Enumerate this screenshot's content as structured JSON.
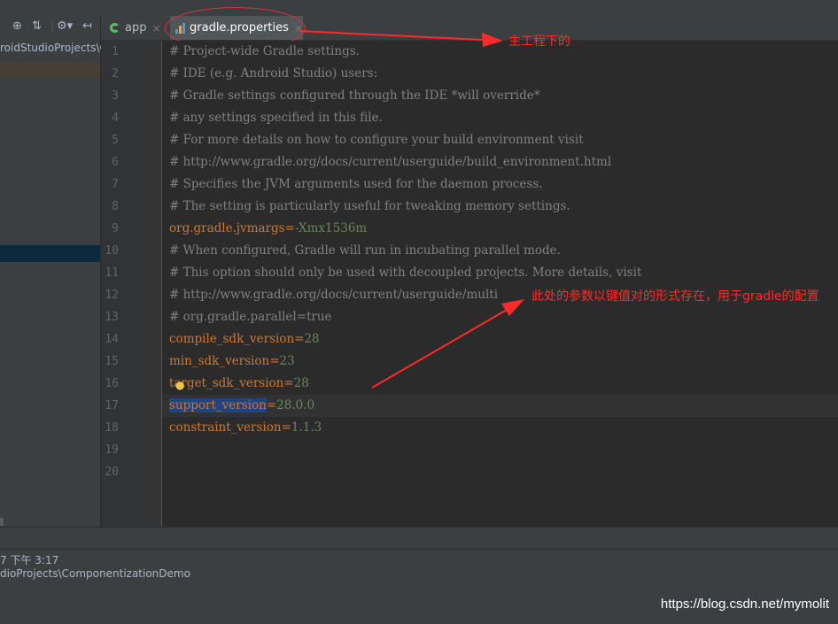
{
  "project_panel": {
    "path_fragment": "roidStudioProjects\\C"
  },
  "tabs": [
    {
      "label": "app",
      "close": "×"
    },
    {
      "label": "gradle.properties",
      "close": "×"
    }
  ],
  "editor": {
    "lines": [
      {
        "num": "1",
        "comment": "# Project-wide Gradle settings."
      },
      {
        "num": "2",
        "comment": "# IDE (e.g. Android Studio) users:"
      },
      {
        "num": "3",
        "comment": "# Gradle settings configured through the IDE *will override*"
      },
      {
        "num": "4",
        "comment": "# any settings specified in this file."
      },
      {
        "num": "5",
        "comment": "# For more details on how to configure your build environment visit"
      },
      {
        "num": "6",
        "comment": "# http://www.gradle.org/docs/current/userguide/build_environment.html"
      },
      {
        "num": "7",
        "comment": "# Specifies the JVM arguments used for the daemon process."
      },
      {
        "num": "8",
        "comment": "# The setting is particularly useful for tweaking memory settings."
      },
      {
        "num": "9",
        "key": "org.gradle.jvmargs",
        "eq": "=",
        "value": "-Xmx1536m"
      },
      {
        "num": "10",
        "comment": "# When configured, Gradle will run in incubating parallel mode."
      },
      {
        "num": "11",
        "comment": "# This option should only be used with decoupled projects. More details, visit"
      },
      {
        "num": "12",
        "comment": "# http://www.gradle.org/docs/current/userguide/multi"
      },
      {
        "num": "13",
        "comment": "# org.gradle.parallel=true"
      },
      {
        "num": "14",
        "key": "compile_sdk_version",
        "eq": "=",
        "value": "28"
      },
      {
        "num": "15",
        "key": "min_sdk_version",
        "eq": "=",
        "value": "23"
      },
      {
        "num": "16",
        "key": "target_sdk_version",
        "eq": "=",
        "value": "28"
      },
      {
        "num": "17",
        "key": "support_version",
        "eq": "=",
        "value": "28.0.0"
      },
      {
        "num": "18",
        "key": "constraint_version",
        "eq": "=",
        "value": "1.1.3"
      },
      {
        "num": "19"
      },
      {
        "num": "20"
      }
    ]
  },
  "status": {
    "time": "7 下午 3:17",
    "path": "dioProjects\\ComponentizationDemo"
  },
  "annotations": {
    "main_project": "主工程下的",
    "params_note": "此处的参数以键值对的形式存在，用于gradle的配置"
  },
  "watermark": "https://blog.csdn.net/mymolit",
  "colors": {
    "annotation": "#ff2a2a",
    "comment": "#808080",
    "key": "#cc7832",
    "value": "#6a8759"
  }
}
